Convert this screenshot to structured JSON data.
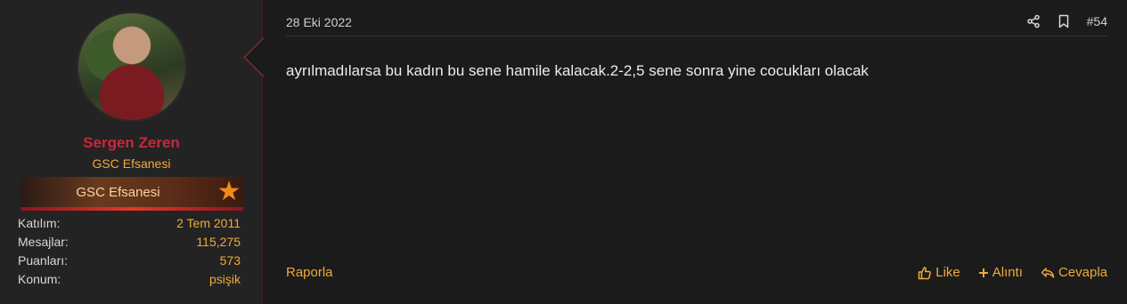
{
  "user": {
    "name": "Sergen Zeren",
    "title": "GSC Efsanesi",
    "banner": "GSC Efsanesi",
    "stats": [
      {
        "label": "Katılım:",
        "value": "2 Tem 2011"
      },
      {
        "label": "Mesajlar:",
        "value": "115,275"
      },
      {
        "label": "Puanları:",
        "value": "573"
      },
      {
        "label": "Konum:",
        "value": "psişik"
      }
    ]
  },
  "post": {
    "date": "28 Eki 2022",
    "number": "#54",
    "message": "ayrılmadılarsa bu kadın bu sene hamile kalacak.2-2,5 sene sonra yine cocukları olacak"
  },
  "footer": {
    "report": "Raporla",
    "like": "Like",
    "quote": "Alıntı",
    "reply": "Cevapla"
  },
  "colors": {
    "accent": "#f0a93a",
    "username": "#c8283a",
    "background": "#1b1b1b"
  },
  "icons": [
    "share-icon",
    "bookmark-icon",
    "thumbs-up-icon",
    "plus-icon",
    "reply-icon",
    "star-icon"
  ]
}
